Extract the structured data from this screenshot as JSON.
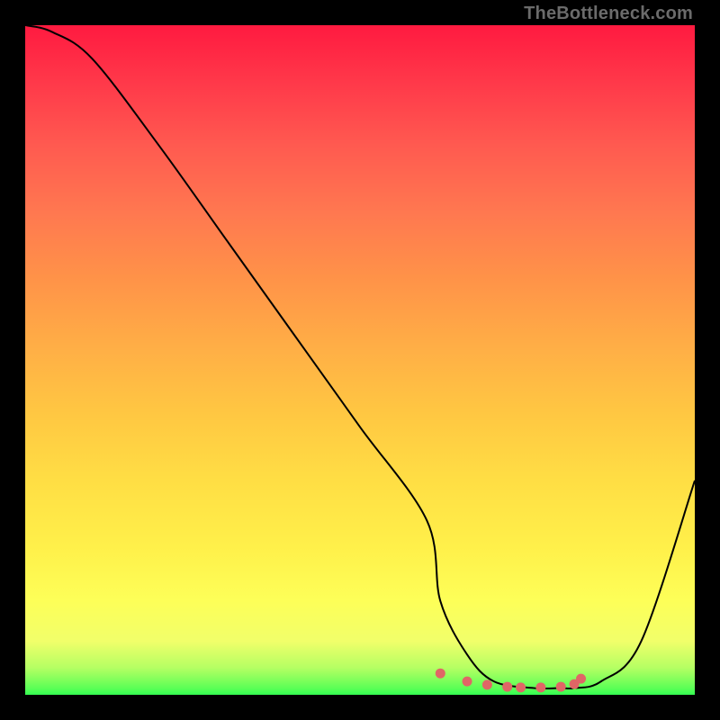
{
  "watermark": "TheBottleneck.com",
  "chart_data": {
    "type": "line",
    "title": "",
    "xlabel": "",
    "ylabel": "",
    "xlim": [
      0,
      100
    ],
    "ylim": [
      0,
      100
    ],
    "grid": false,
    "series": [
      {
        "name": "bottleneck-curve",
        "x": [
          0,
          4,
          10,
          20,
          30,
          40,
          50,
          60,
          62,
          66,
          70,
          76,
          80,
          82,
          86,
          92,
          100
        ],
        "values": [
          100,
          99,
          95,
          82,
          68,
          54,
          40,
          26,
          14,
          6,
          2,
          1,
          1,
          1,
          2,
          8,
          32
        ]
      }
    ],
    "flat_region_markers": {
      "name": "optimal-range-dots",
      "x": [
        62,
        66,
        69,
        72,
        74,
        77,
        80,
        82,
        83
      ],
      "values": [
        3.2,
        2.0,
        1.5,
        1.2,
        1.1,
        1.1,
        1.2,
        1.6,
        2.4
      ],
      "color": "#e06666"
    },
    "background_gradient": {
      "orientation": "vertical",
      "stops": [
        {
          "pos": 0.0,
          "color": "#ff1a40"
        },
        {
          "pos": 0.48,
          "color": "#ffae46"
        },
        {
          "pos": 0.86,
          "color": "#fdff58"
        },
        {
          "pos": 1.0,
          "color": "#34ff52"
        }
      ]
    }
  }
}
